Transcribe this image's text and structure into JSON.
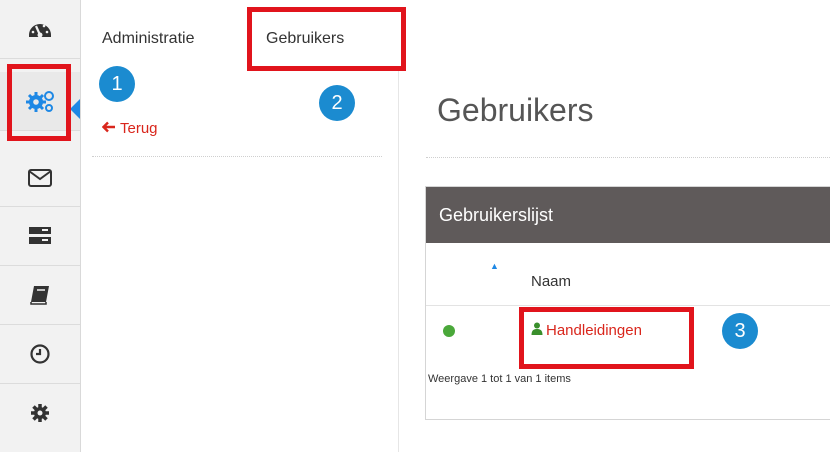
{
  "sidebar": {
    "items": [
      {
        "icon": "dashboard-icon"
      },
      {
        "icon": "gears-icon",
        "active": true
      },
      {
        "icon": "envelope-icon"
      },
      {
        "icon": "server-icon"
      },
      {
        "icon": "book-icon"
      },
      {
        "icon": "clock-icon"
      },
      {
        "icon": "gear-icon"
      }
    ]
  },
  "topbar": {
    "tabs": [
      {
        "label": "Administratie"
      },
      {
        "label": "Gebruikers"
      }
    ]
  },
  "subnav": {
    "back_label": "Terug"
  },
  "main": {
    "title": "Gebruikers",
    "panel": {
      "title": "Gebruikerslijst",
      "column": "Naam",
      "rows": [
        {
          "name": "Handleidingen",
          "status_color": "#4aa83a"
        }
      ],
      "pager": "Weergave 1 tot 1 van 1 items"
    }
  },
  "annotations": {
    "badges": [
      "1",
      "2",
      "3"
    ],
    "highlight_color": "#e1141c",
    "badge_color": "#1b8bd0"
  },
  "colors": {
    "accent": "#d9261c",
    "panel_header": "#5f5a5a"
  }
}
